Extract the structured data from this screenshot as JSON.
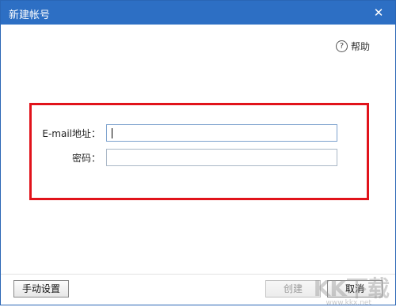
{
  "dialog": {
    "title": "新建帐号",
    "close_glyph": "✕",
    "help_label": "帮助",
    "help_icon_glyph": "?"
  },
  "form": {
    "email_label": "E-mail地址：",
    "email_value": "",
    "password_label": "密码：",
    "password_value": ""
  },
  "buttons": {
    "manual_settings": "手动设置",
    "create": "创建",
    "cancel": "取消"
  },
  "watermark": {
    "logo_text": "KK下载",
    "site": "www.kkx.net"
  },
  "colors": {
    "titlebar": "#2d6fc4",
    "highlight_frame": "#e1131b"
  }
}
